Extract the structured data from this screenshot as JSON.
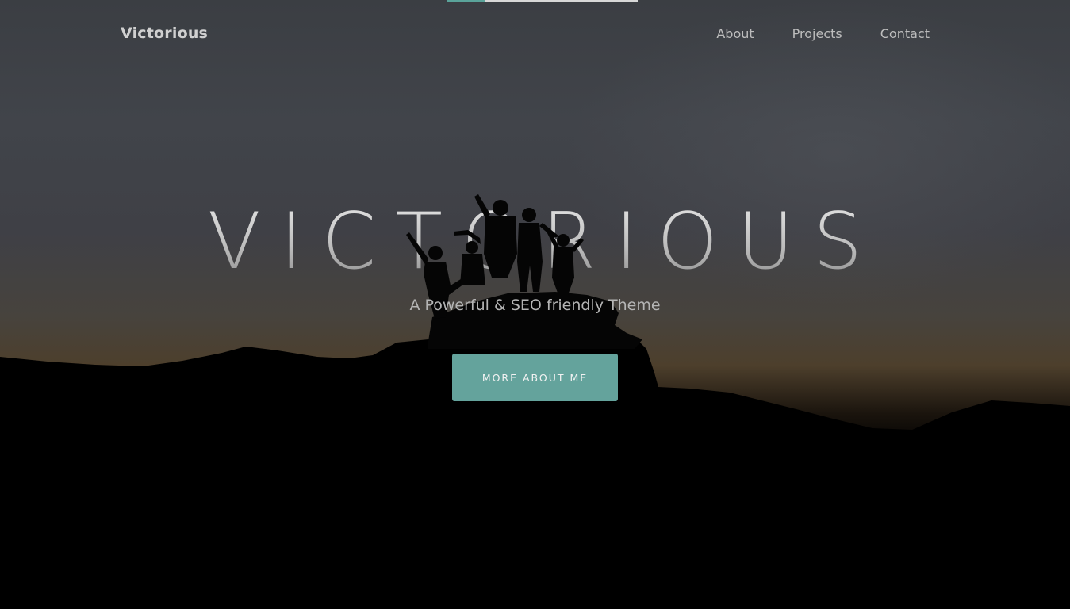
{
  "navbar": {
    "brand": "Victorious",
    "links": [
      "About",
      "Projects",
      "Contact"
    ]
  },
  "scroll_progress": 0.2,
  "hero": {
    "title": "VICTORIOUS",
    "subtitle": "A Powerful & SEO friendly Theme",
    "cta_label": "MORE ABOUT ME"
  },
  "colors": {
    "accent": "#64a39c",
    "progress_fill": "#5aa39a",
    "progress_track": "#d8d8d8",
    "sky_top": "#3b3e43",
    "horizon": "#4d3f2c",
    "ground": "#000000"
  }
}
